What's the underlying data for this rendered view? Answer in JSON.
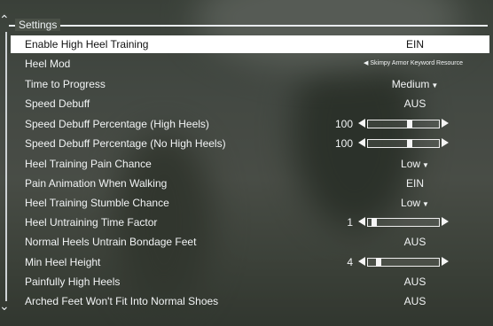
{
  "panel": {
    "title": "Settings"
  },
  "rows": [
    {
      "label": "Enable High Heel Training",
      "value": "EIN",
      "selected": true
    },
    {
      "label": "Heel Mod",
      "value": "Skimpy Armor Keyword Resource"
    },
    {
      "label": "Time to Progress",
      "value": "Medium"
    },
    {
      "label": "Speed Debuff",
      "value": "AUS"
    },
    {
      "label": "Speed Debuff Percentage (High Heels)",
      "value": "100",
      "slider_fraction": 0.6
    },
    {
      "label": "Speed Debuff Percentage (No High Heels)",
      "value": "100",
      "slider_fraction": 0.6
    },
    {
      "label": "Heel Training Pain Chance",
      "value": "Low"
    },
    {
      "label": "Pain Animation When Walking",
      "value": "EIN"
    },
    {
      "label": "Heel Training Stumble Chance",
      "value": "Low"
    },
    {
      "label": "Heel Untraining Time Factor",
      "value": "1",
      "slider_fraction": 0.05
    },
    {
      "label": "Normal Heels Untrain Bondage Feet",
      "value": "AUS"
    },
    {
      "label": "Min Heel Height",
      "value": "4",
      "slider_fraction": 0.12
    },
    {
      "label": "Painfully High Heels",
      "value": "AUS"
    },
    {
      "label": "Arched Feet Won't Fit Into Normal Shoes",
      "value": "AUS"
    }
  ],
  "colors": {
    "text": "#f2f4f5",
    "selected_bg": "#ffffff",
    "selected_text": "#111111"
  }
}
